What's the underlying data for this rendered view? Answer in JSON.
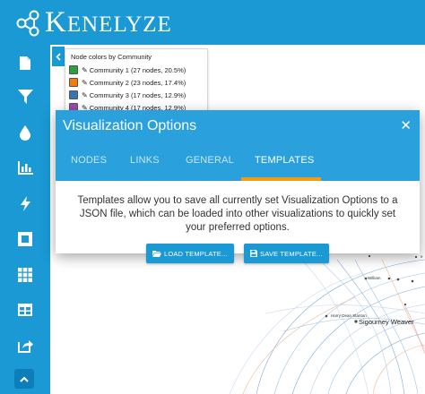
{
  "app": {
    "brand": "Kenelyze",
    "brand_first": "K",
    "brand_rest": "ENELYZE"
  },
  "sidebar": {
    "items": [
      {
        "icon": "file-icon"
      },
      {
        "icon": "filter-icon"
      },
      {
        "icon": "drop-icon"
      },
      {
        "icon": "bar-chart-icon"
      },
      {
        "icon": "bolt-icon"
      },
      {
        "icon": "crop-icon"
      },
      {
        "icon": "grid-icon"
      },
      {
        "icon": "table-icon"
      },
      {
        "icon": "share-icon"
      }
    ],
    "collapse_icon": "chevron-up-icon"
  },
  "legend": {
    "title": "Node colors by Community",
    "items": [
      {
        "label": "Community 1 (27 nodes, 20.5%)",
        "color": "#2e9e3a"
      },
      {
        "label": "Community 2 (23 nodes, 17.4%)",
        "color": "#f47b0f"
      },
      {
        "label": "Community 3 (17 nodes, 12.9%)",
        "color": "#3276b5"
      },
      {
        "label": "Community 4 (17 nodes, 12.9%)",
        "color": "#9b4ba6"
      }
    ]
  },
  "modal": {
    "title": "Visualization Options",
    "tabs": [
      "NODES",
      "LINKS",
      "GENERAL",
      "TEMPLATES"
    ],
    "active_tab": "TEMPLATES",
    "body_text": "Templates allow you to save all currently set Visualization Options to a JSON file, which can be loaded into other visualizations to quickly set your preferred options.",
    "load_button": "LOAD TEMPLATE...",
    "save_button": "SAVE TEMPLATE..."
  },
  "graph": {
    "labels": {
      "william": "William",
      "harry": "Harry Dean Stanton",
      "sigourney": "Sigourney Weaver",
      "partial": "e"
    }
  },
  "colors": {
    "header": "#1a99d5",
    "modal_header": "#2aa1dc",
    "tab_indicator": "#f39c12",
    "button": "#1a99d5"
  }
}
